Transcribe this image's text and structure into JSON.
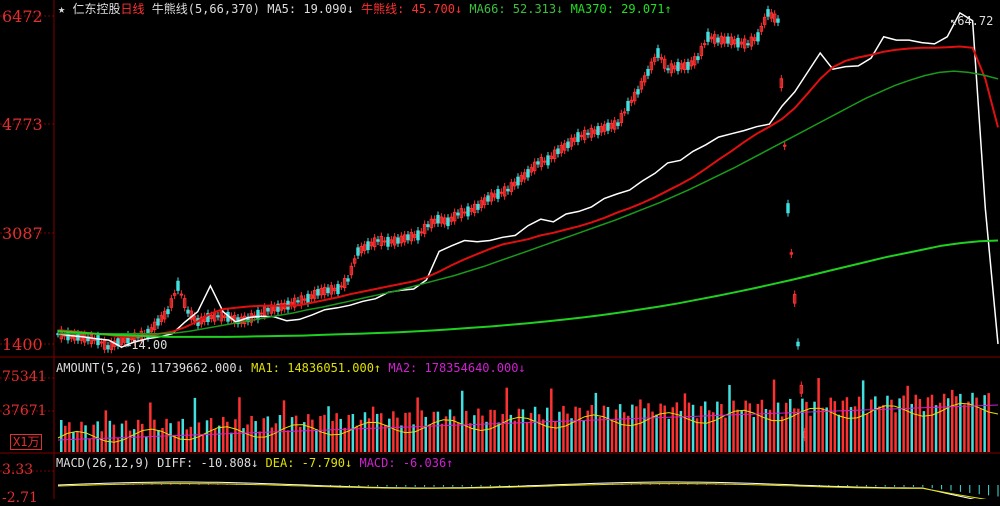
{
  "header": {
    "star": "★",
    "stock_name": "仁东控股",
    "period": "日线",
    "indicator": "牛熊线(5,66,370)",
    "ma5_label": "MA5: 19.090↓",
    "bull_bear_label": "牛熊线: 45.700↓",
    "ma66_label": "MA66: 52.313↓",
    "ma370_label": "MA370: 29.071↑"
  },
  "price_axis": {
    "ticks": [
      "6472",
      "4773",
      "3087",
      "1400"
    ]
  },
  "annotations": {
    "high": "64.72",
    "low": "14.00"
  },
  "amount_panel": {
    "title": "AMOUNT(5,26)",
    "value": "11739662.000↓",
    "ma1": "MA1: 14836051.000↑",
    "ma2": "MA2: 178354640.000↓",
    "ticks": [
      "75341",
      "37671"
    ],
    "unit": "X1万"
  },
  "macd_panel": {
    "title": "MACD(26,12,9)",
    "diff": "DIFF: -10.808↓",
    "dea": "DEA: -7.790↓",
    "macd": "MACD: -6.036↑",
    "ticks": [
      "3.33",
      "-2.71"
    ]
  },
  "colors": {
    "up": "#ff3030",
    "down": "#40e0e0",
    "ma5": "#ffffff",
    "bull_bear": "#e01010",
    "ma66": "#1a9a1a",
    "ma370": "#20d020",
    "amount_ma1": "#e0e000",
    "amount_ma2": "#d020d0",
    "macd_dea": "#e0e000",
    "grid": "#800000",
    "axis_text": "#e03030"
  },
  "chart_data": {
    "type": "line",
    "title": "仁东控股 日线",
    "y_unit": "price",
    "ylim": [
      1400,
      6472
    ],
    "note_low": 14.0,
    "note_high": 64.72,
    "x": [
      0,
      10,
      20,
      30,
      40,
      50,
      60,
      70,
      80,
      90,
      100,
      110,
      120,
      130,
      140,
      150,
      160,
      170,
      180,
      190,
      200,
      210,
      220,
      230,
      240,
      250,
      260,
      270,
      280,
      290,
      300,
      310,
      320,
      330,
      340,
      350,
      360,
      370,
      380,
      390,
      400,
      410,
      420,
      430,
      440,
      450,
      460,
      470,
      480,
      490,
      500,
      510,
      520,
      530,
      540,
      550,
      560,
      570,
      580,
      590,
      600,
      610,
      620,
      630,
      640,
      650,
      660,
      670,
      680,
      690,
      700,
      710,
      720,
      730,
      740,
      750,
      760,
      770,
      780,
      790,
      800,
      810,
      820,
      830,
      840,
      850,
      860,
      870,
      880,
      890,
      900,
      910,
      920,
      930,
      940
    ],
    "series": [
      {
        "name": "MA5",
        "values": [
          1560,
          1530,
          1510,
          1480,
          1460,
          1350,
          1430,
          1480,
          1510,
          1560,
          1740,
          1900,
          2300,
          1900,
          1740,
          1810,
          1830,
          1820,
          1760,
          1780,
          1850,
          1930,
          1960,
          2000,
          2060,
          2100,
          2200,
          2230,
          2250,
          2390,
          2830,
          2920,
          3000,
          2980,
          3000,
          3050,
          3080,
          3230,
          3330,
          3290,
          3410,
          3450,
          3520,
          3650,
          3720,
          3780,
          3920,
          4040,
          4200,
          4240,
          4380,
          4480,
          4600,
          4650,
          4700,
          4760,
          4800,
          5080,
          5300,
          5600,
          5900,
          5650,
          5690,
          5700,
          5820,
          6150,
          6100,
          6100,
          6060,
          6040,
          6150,
          6520,
          6400,
          3500,
          1400
        ]
      },
      {
        "name": "牛熊线",
        "values": [
          1610,
          1600,
          1580,
          1560,
          1540,
          1510,
          1510,
          1530,
          1560,
          1590,
          1660,
          1750,
          1870,
          1940,
          1960,
          1980,
          1990,
          1990,
          1990,
          2000,
          2040,
          2080,
          2120,
          2170,
          2210,
          2250,
          2290,
          2330,
          2370,
          2430,
          2520,
          2620,
          2710,
          2790,
          2870,
          2940,
          2980,
          3020,
          3080,
          3120,
          3170,
          3220,
          3280,
          3350,
          3430,
          3500,
          3580,
          3670,
          3770,
          3870,
          3980,
          4110,
          4250,
          4380,
          4520,
          4650,
          4760,
          4880,
          5050,
          5270,
          5500,
          5680,
          5780,
          5830,
          5870,
          5920,
          5950,
          5970,
          5980,
          5980,
          5990,
          6000,
          5980,
          5500,
          4750
        ]
      },
      {
        "name": "MA66",
        "values": [
          1560,
          1560,
          1560,
          1560,
          1560,
          1560,
          1560,
          1560,
          1570,
          1600,
          1640,
          1680,
          1720,
          1760,
          1800,
          1840,
          1880,
          1930,
          1970,
          2020,
          2070,
          2120,
          2170,
          2220,
          2280,
          2340,
          2400,
          2460,
          2530,
          2600,
          2680,
          2760,
          2840,
          2920,
          3000,
          3080,
          3160,
          3240,
          3320,
          3410,
          3500,
          3590,
          3690,
          3790,
          3900,
          4010,
          4120,
          4240,
          4360,
          4480,
          4600,
          4720,
          4840,
          4960,
          5080,
          5200,
          5300,
          5400,
          5480,
          5550,
          5600,
          5620,
          5600,
          5560,
          5500
        ]
      },
      {
        "name": "MA370",
        "values": [
          1600,
          1580,
          1560,
          1540,
          1530,
          1520,
          1510,
          1510,
          1510,
          1510,
          1515,
          1520,
          1525,
          1530,
          1540,
          1550,
          1560,
          1570,
          1580,
          1595,
          1610,
          1630,
          1650,
          1670,
          1695,
          1720,
          1750,
          1780,
          1815,
          1850,
          1890,
          1935,
          1980,
          2030,
          2085,
          2140,
          2200,
          2260,
          2325,
          2390,
          2460,
          2530,
          2600,
          2670,
          2740,
          2800,
          2860,
          2920,
          2960,
          2990,
          3000
        ]
      }
    ]
  }
}
